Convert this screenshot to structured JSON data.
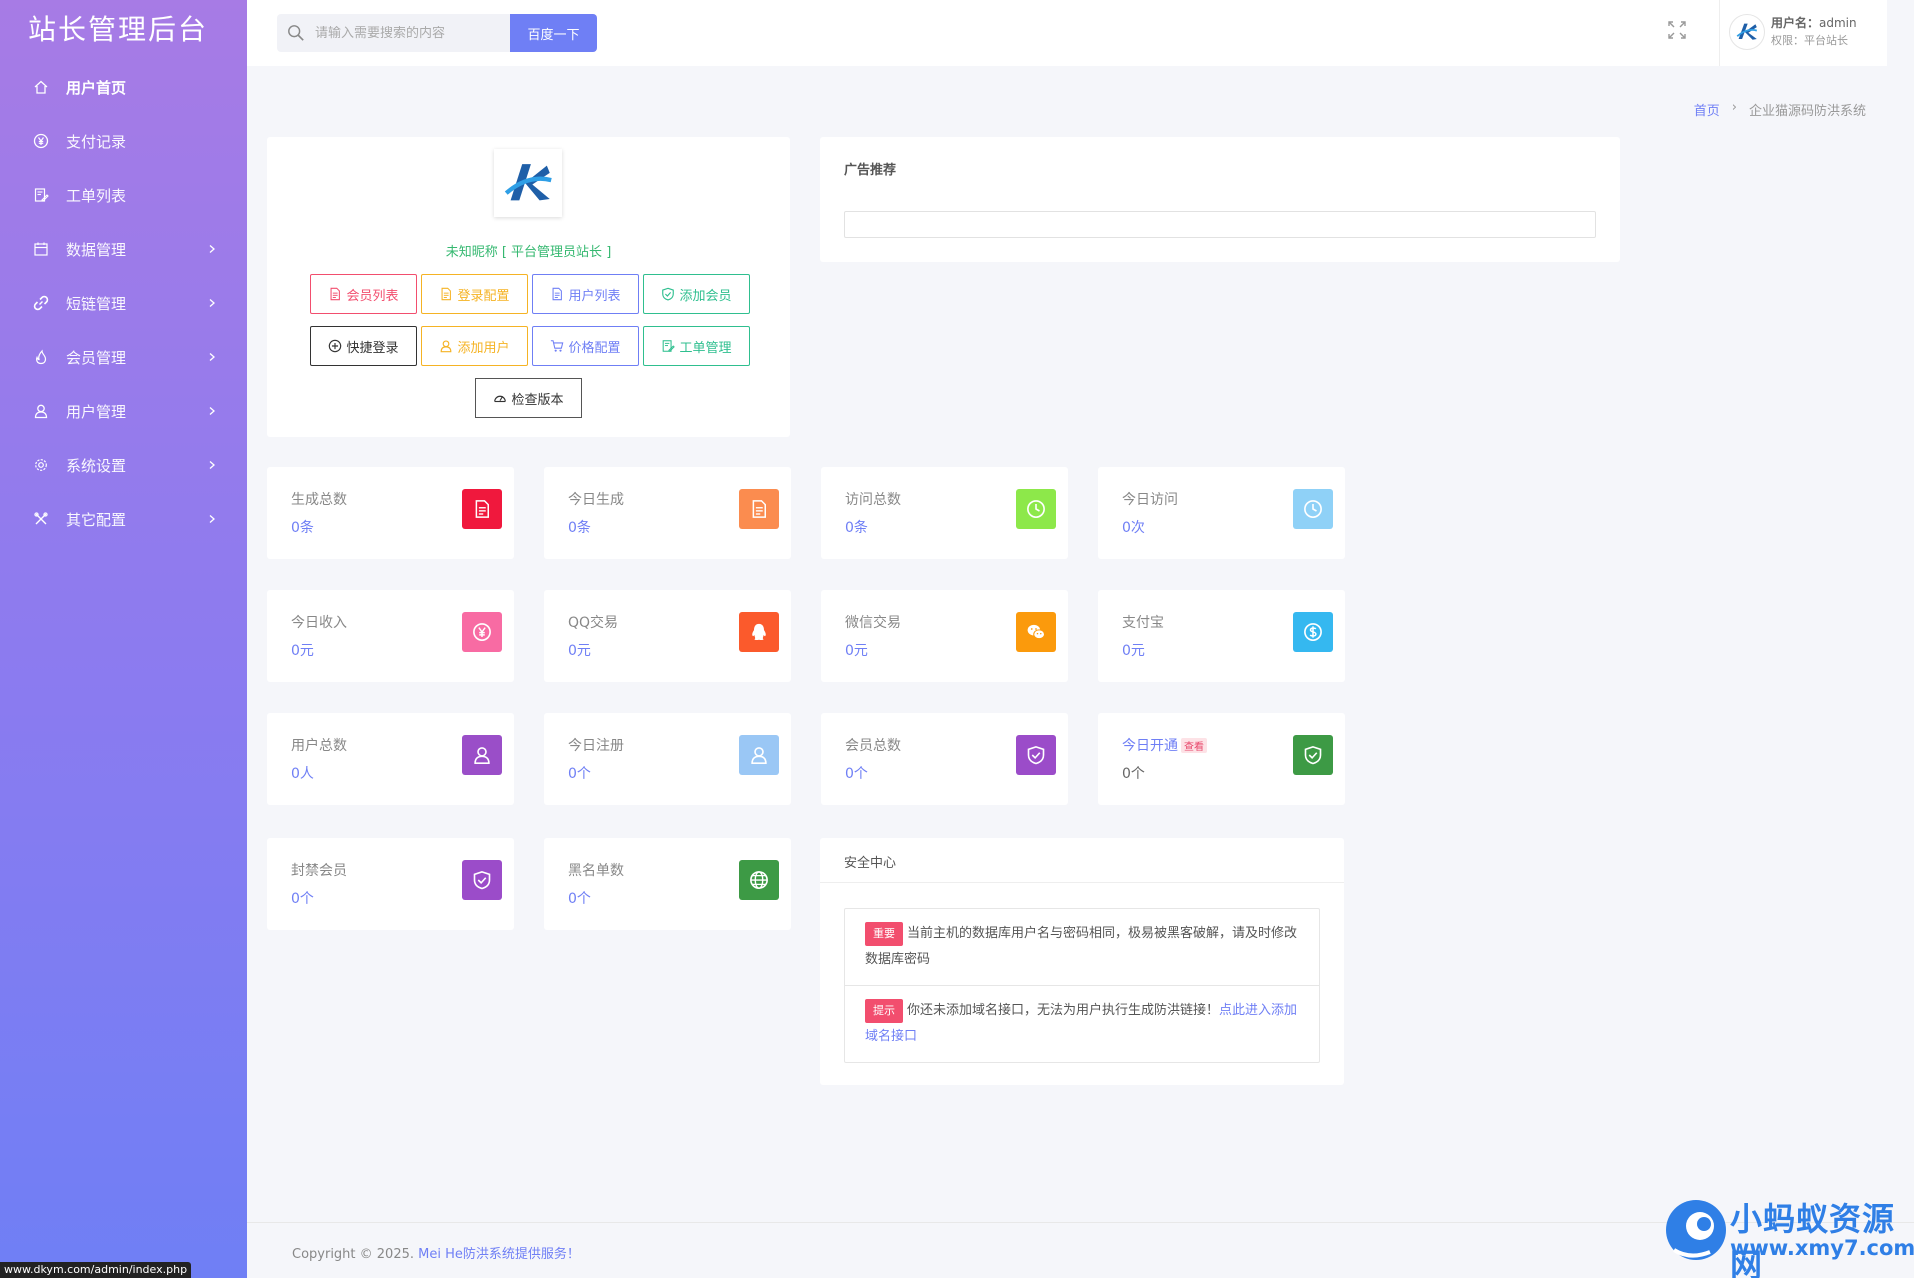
{
  "brand": "站长管理后台",
  "sidebar": {
    "items": [
      {
        "label": "用户首页",
        "icon": "home-icon",
        "active": true,
        "has_children": false
      },
      {
        "label": "支付记录",
        "icon": "yen-circle-icon",
        "active": false,
        "has_children": false
      },
      {
        "label": "工单列表",
        "icon": "ticket-edit-icon",
        "active": false,
        "has_children": false
      },
      {
        "label": "数据管理",
        "icon": "calendar-icon",
        "active": false,
        "has_children": true
      },
      {
        "label": "短链管理",
        "icon": "link-icon",
        "active": false,
        "has_children": true
      },
      {
        "label": "会员管理",
        "icon": "fire-icon",
        "active": false,
        "has_children": true
      },
      {
        "label": "用户管理",
        "icon": "user-icon",
        "active": false,
        "has_children": true
      },
      {
        "label": "系统设置",
        "icon": "gear-icon",
        "active": false,
        "has_children": true
      },
      {
        "label": "其它配置",
        "icon": "tools-icon",
        "active": false,
        "has_children": true
      }
    ]
  },
  "topbar": {
    "search_placeholder": "请输入需要搜索的内容",
    "search_button": "百度一下",
    "user_label": "用户名：",
    "user_name": "admin",
    "role": "权限：平台站长"
  },
  "breadcrumb": {
    "home": "首页",
    "separator": "›",
    "current": "企业猫源码防洪系统"
  },
  "profile": {
    "name": "未知昵称 [ 平台管理员站长 ]",
    "row1": [
      {
        "label": "会员列表",
        "color": "#f24e6e",
        "icon": "document-icon"
      },
      {
        "label": "登录配置",
        "color": "#f5b324",
        "icon": "document-icon"
      },
      {
        "label": "用户列表",
        "color": "#6f7ff5",
        "icon": "document-icon"
      },
      {
        "label": "添加会员",
        "color": "#2fbf8f",
        "icon": "shield-check-icon"
      }
    ],
    "row2": [
      {
        "label": "快捷登录",
        "color": "#333333",
        "icon": "plus-circle-icon"
      },
      {
        "label": "添加用户",
        "color": "#f5b324",
        "icon": "user-icon"
      },
      {
        "label": "价格配置",
        "color": "#6f7ff5",
        "icon": "cart-icon"
      },
      {
        "label": "工单管理",
        "color": "#2fbf8f",
        "icon": "ticket-edit-icon"
      }
    ],
    "check_version": "检查版本"
  },
  "ad": {
    "title": "广告推荐"
  },
  "stats": [
    {
      "label": "生成总数",
      "value": "0条",
      "bg": "#f0183d",
      "icon": "document-icon"
    },
    {
      "label": "今日生成",
      "value": "0条",
      "bg": "#fb8c4f",
      "icon": "document-icon"
    },
    {
      "label": "访问总数",
      "value": "0条",
      "bg": "#8de84a",
      "icon": "clock-icon"
    },
    {
      "label": "今日访问",
      "value": "0次",
      "bg": "#8fd1f7",
      "icon": "clock-icon"
    },
    {
      "label": "今日收入",
      "value": "0元",
      "bg": "#f86ba3",
      "icon": "yen-circle-icon"
    },
    {
      "label": "QQ交易",
      "value": "0元",
      "bg": "#fb5a2c",
      "icon": "qq-icon"
    },
    {
      "label": "微信交易",
      "value": "0元",
      "bg": "#fb9a0c",
      "icon": "wechat-icon"
    },
    {
      "label": "支付宝",
      "value": "0元",
      "bg": "#35b8f0",
      "icon": "dollar-circle-icon"
    },
    {
      "label": "用户总数",
      "value": "0人",
      "bg": "#9a4ec8",
      "icon": "user-icon"
    },
    {
      "label": "今日注册",
      "value": "0个",
      "bg": "#9ac7f5",
      "icon": "user-icon"
    },
    {
      "label": "会员总数",
      "value": "0个",
      "bg": "#9b4cc9",
      "icon": "shield-check-icon"
    },
    {
      "label": "今日开通",
      "value": "0个",
      "bg": "#3d9a45",
      "icon": "shield-check-icon",
      "badge": "查看"
    },
    {
      "label": "封禁会员",
      "value": "0个",
      "bg": "#9b4cc9",
      "icon": "shield-check-icon"
    },
    {
      "label": "黑名单数",
      "value": "0个",
      "bg": "#3d9a45",
      "icon": "globe-icon"
    }
  ],
  "security": {
    "title": "安全中心",
    "items": [
      {
        "badge": "重要",
        "text": "当前主机的数据库用户名与密码相同，极易被黑客破解，请及时修改数据库密码",
        "link": ""
      },
      {
        "badge": "提示",
        "text": "你还未添加域名接口，无法为用户执行生成防洪链接！",
        "link": "点此进入添加域名接口"
      }
    ]
  },
  "footer": {
    "prefix": "Copyright © 2025.",
    "link": "Mei He防洪系统提供服务！"
  },
  "status_url": "www.dkym.com/admin/index.php",
  "watermark": {
    "line1": "小蚂蚁资源网",
    "line2": "www.xmy7.com"
  }
}
